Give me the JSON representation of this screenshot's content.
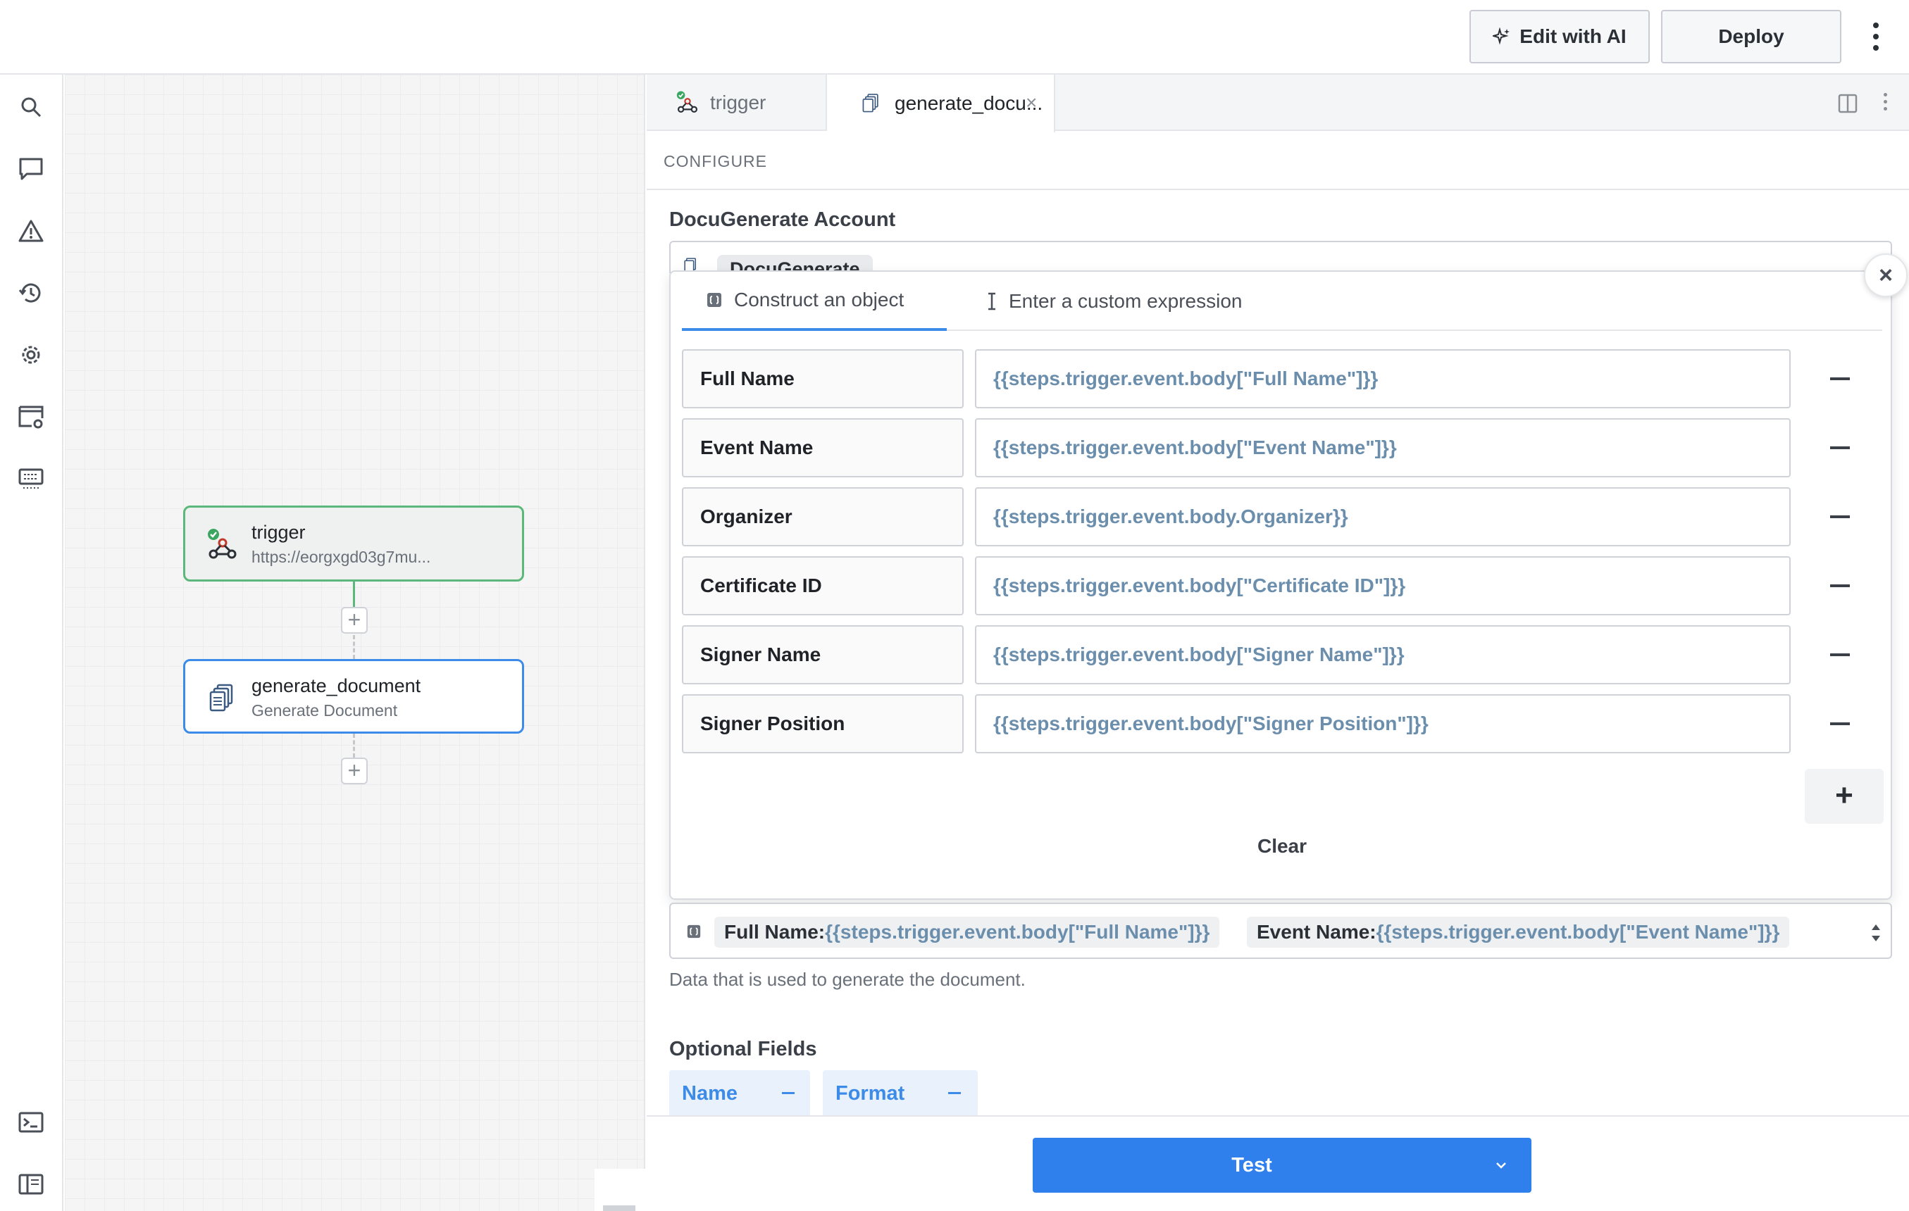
{
  "topbar": {
    "edit_ai_label": "Edit with AI",
    "deploy_label": "Deploy"
  },
  "rail": {
    "icons": [
      "search-icon",
      "comment-icon",
      "warning-icon",
      "history-icon",
      "settings-icon",
      "browser-settings-icon",
      "keyboard-icon",
      "terminal-icon",
      "sidebar-layout-icon"
    ]
  },
  "canvas": {
    "nodes": [
      {
        "title": "trigger",
        "subtitle": "https://eorgxgd03g7mu..."
      },
      {
        "title": "generate_document",
        "subtitle": "Generate Document"
      }
    ]
  },
  "tabs": [
    {
      "label": "trigger"
    },
    {
      "label": "generate_docu..."
    }
  ],
  "config": {
    "section": "CONFIGURE",
    "account_label": "DocuGenerate Account",
    "account_value": "DocuGenerate",
    "popover": {
      "tab_construct": "Construct an object",
      "tab_custom": "Enter a custom expression",
      "rows": [
        {
          "key": "Full Name",
          "value": "{{steps.trigger.event.body[\"Full Name\"]}}"
        },
        {
          "key": "Event Name",
          "value": "{{steps.trigger.event.body[\"Event Name\"]}}"
        },
        {
          "key": "Organizer",
          "value": "{{steps.trigger.event.body.Organizer}}"
        },
        {
          "key": "Certificate ID",
          "value": "{{steps.trigger.event.body[\"Certificate ID\"]}}"
        },
        {
          "key": "Signer Name",
          "value": "{{steps.trigger.event.body[\"Signer Name\"]}}"
        },
        {
          "key": "Signer Position",
          "value": "{{steps.trigger.event.body[\"Signer Position\"]}}"
        }
      ],
      "clear_label": "Clear"
    },
    "summary": [
      {
        "key": "Full Name:",
        "value": "{{steps.trigger.event.body[\"Full Name\"]}}"
      },
      {
        "key": "Event Name:",
        "value": "{{steps.trigger.event.body[\"Event Name\"]}}"
      }
    ],
    "help_text": "Data that is used to generate the document.",
    "optional_label": "Optional Fields",
    "optional_fields": [
      "Name",
      "Format"
    ]
  },
  "footer": {
    "test_label": "Test"
  },
  "colors": {
    "accent": "#2f80ed",
    "trigger_border": "#5cb87a",
    "expression_text": "#6b8ead"
  }
}
